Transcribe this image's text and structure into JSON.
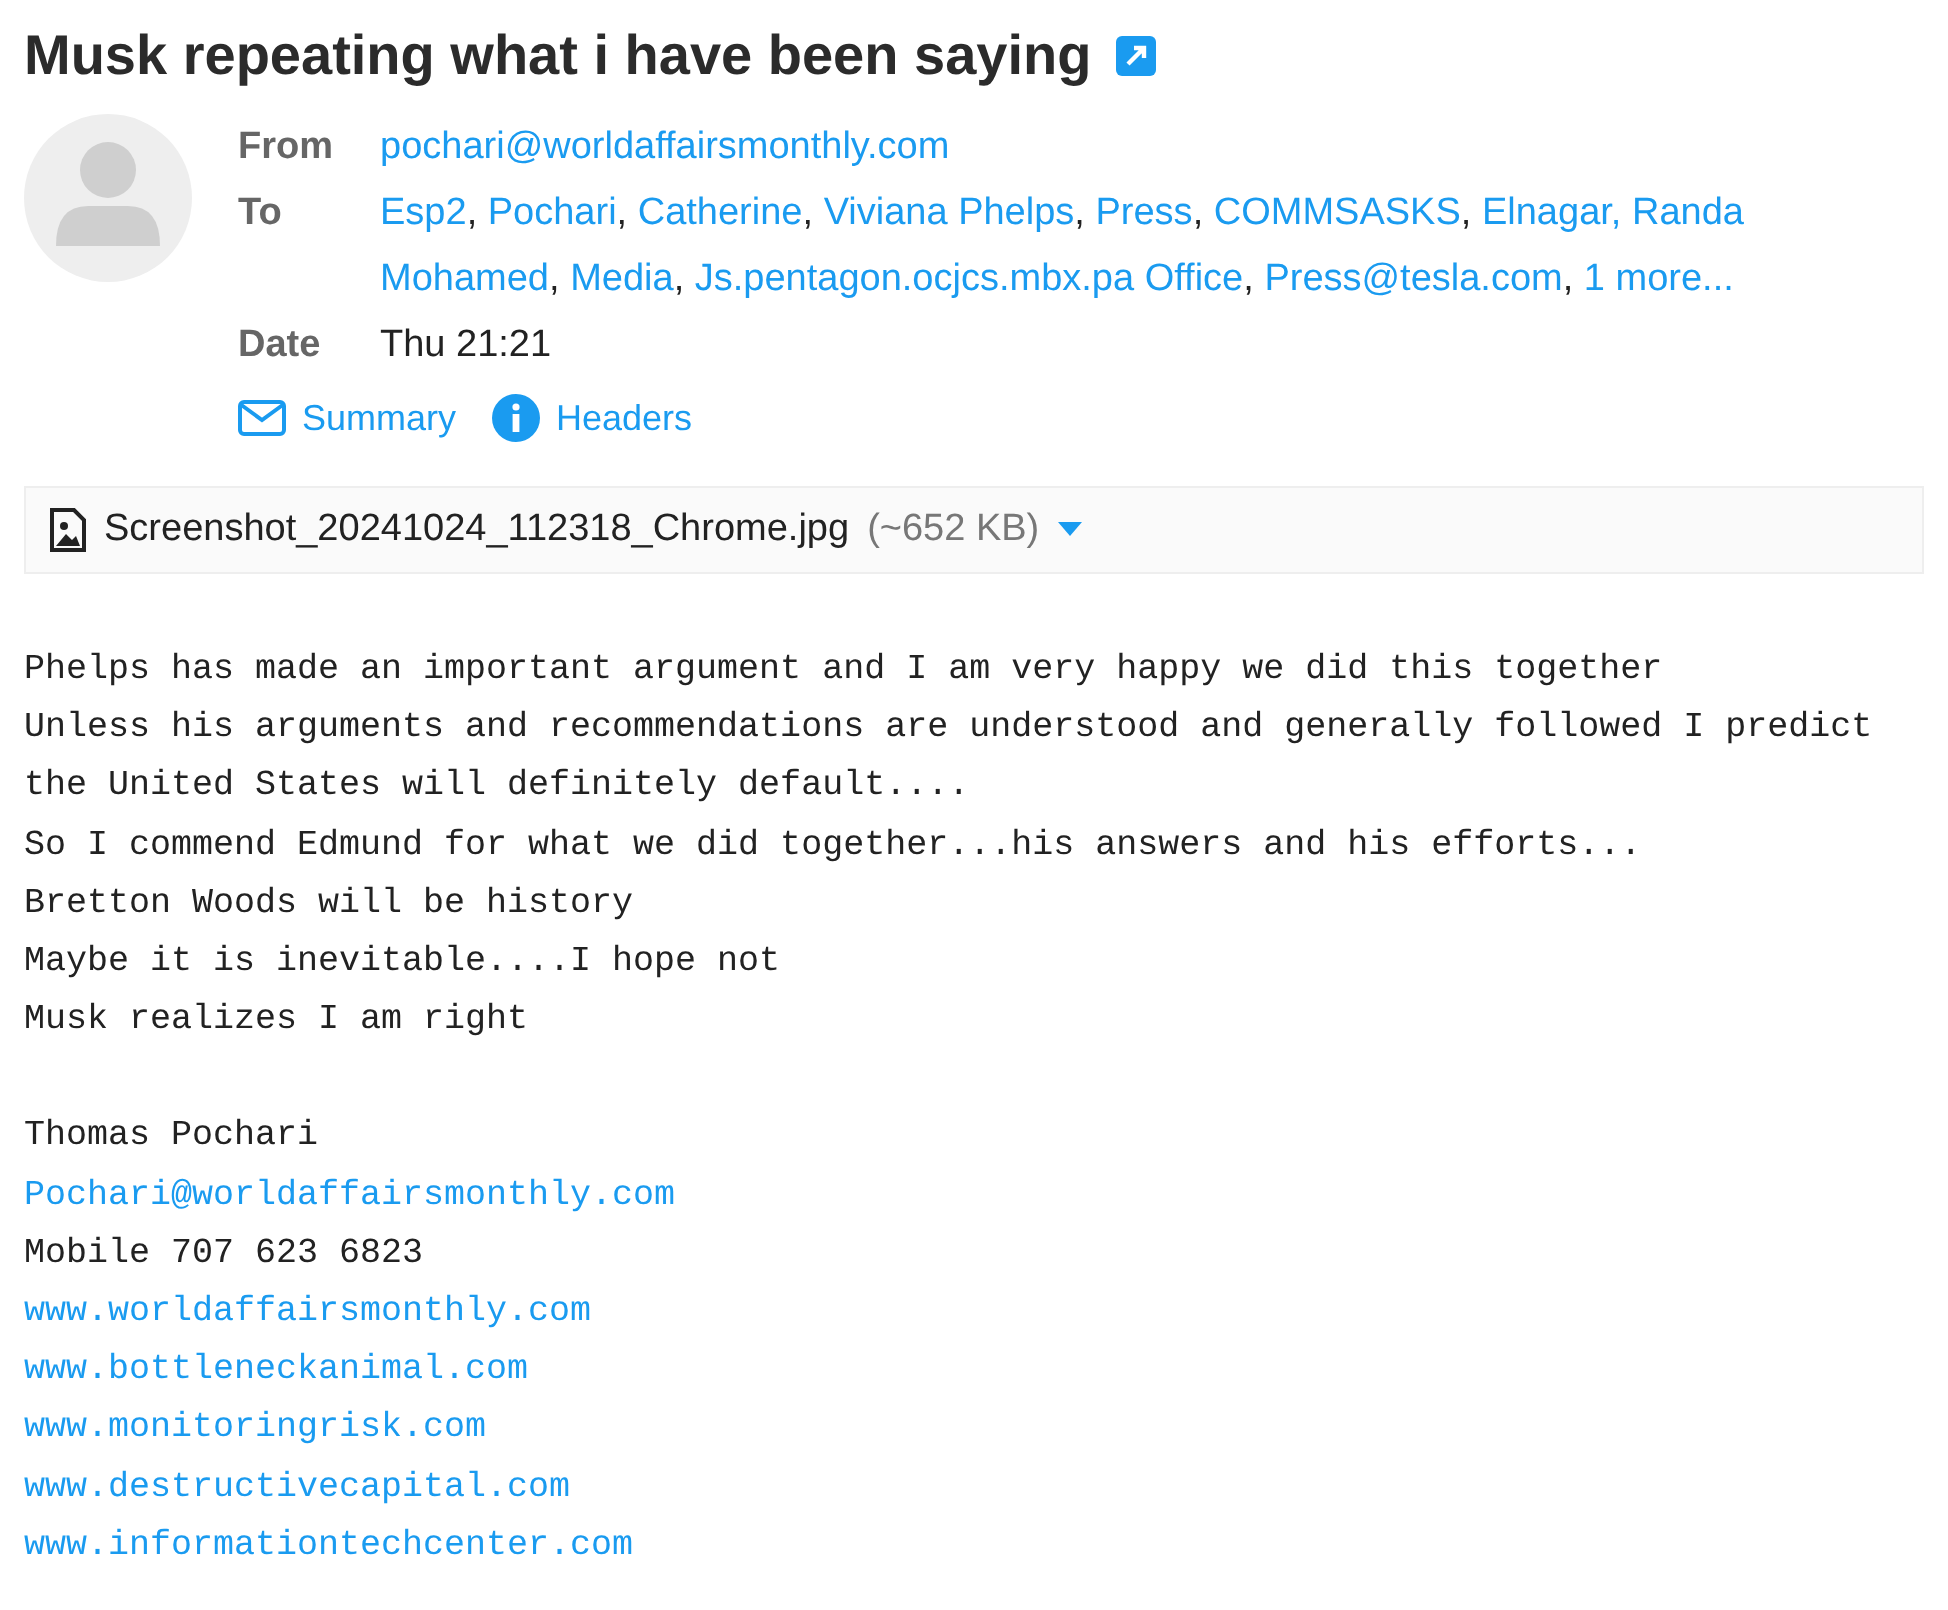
{
  "subject": "Musk repeating what i have been saying",
  "headers": {
    "from_label": "From",
    "from": "pochari@worldaffairsmonthly.com",
    "to_label": "To",
    "to": [
      {
        "name": "Esp2",
        "sep": ","
      },
      {
        "name": "Pochari",
        "sep": ","
      },
      {
        "name": "Catherine",
        "sep": ","
      },
      {
        "name": "Viviana Phelps",
        "sep": ","
      },
      {
        "name": "Press",
        "sep": ","
      },
      {
        "name": "COMMSASKS",
        "sep": ","
      },
      {
        "name": "Elnagar, Randa"
      },
      {
        "name": "Mohamed",
        "sep": ","
      },
      {
        "name": "Media",
        "sep": ","
      },
      {
        "name": "Js.pentagon.ocjcs.mbx.pa Office",
        "sep": ","
      },
      {
        "name": "Press@tesla.com",
        "sep": ","
      },
      {
        "name": "1 more..."
      }
    ],
    "date_label": "Date",
    "date": "Thu 21:21"
  },
  "actions": [
    "Summary",
    "Headers"
  ],
  "attachment": {
    "name": "Screenshot_20241024_112318_Chrome.jpg",
    "size": "(~652 KB)"
  },
  "message": [
    "Phelps has made an important argument and I am very happy we did this together",
    "Unless his arguments and recommendations are understood and generally followed I predict the United States will definitely default....",
    "So I commend Edmund for what we did together...his answers and his efforts...",
    "Bretton Woods will be history",
    "Maybe it is inevitable....I hope not",
    "Musk realizes I am right"
  ],
  "signature": [
    {
      "kind": "text",
      "text": "Thomas Pochari"
    },
    {
      "kind": "link",
      "text": "Pochari@worldaffairsmonthly.com"
    },
    {
      "kind": "text",
      "text": "Mobile 707 623 6823"
    },
    {
      "kind": "link",
      "text": "www.worldaffairsmonthly.com"
    },
    {
      "kind": "link",
      "text": "www.bottleneckanimal.com"
    },
    {
      "kind": "link",
      "text": "www.monitoringrisk.com"
    },
    {
      "kind": "link",
      "text": "www.destructivecapital.com"
    },
    {
      "kind": "link",
      "text": "www.informationtechcenter.com"
    }
  ]
}
